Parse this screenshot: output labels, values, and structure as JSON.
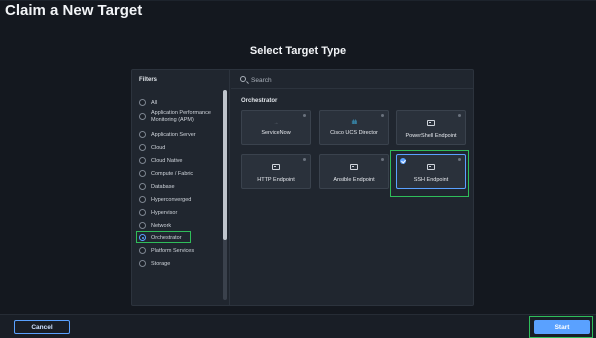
{
  "page": {
    "title": "Claim a New Target"
  },
  "main": {
    "section_title": "Select Target Type"
  },
  "filters": {
    "heading": "Filters",
    "items": [
      {
        "label": "All",
        "selected": false
      },
      {
        "label": "Application Performance Monitoring (APM)",
        "selected": false
      },
      {
        "label": "Application Server",
        "selected": false
      },
      {
        "label": "Cloud",
        "selected": false
      },
      {
        "label": "Cloud Native",
        "selected": false
      },
      {
        "label": "Compute / Fabric",
        "selected": false
      },
      {
        "label": "Database",
        "selected": false
      },
      {
        "label": "Hyperconverged",
        "selected": false
      },
      {
        "label": "Hypervisor",
        "selected": false
      },
      {
        "label": "Network",
        "selected": false
      },
      {
        "label": "Orchestrator",
        "selected": true
      },
      {
        "label": "Platform Services",
        "selected": false
      },
      {
        "label": "Storage",
        "selected": false
      }
    ]
  },
  "search": {
    "placeholder": "Search",
    "value": ""
  },
  "group": {
    "heading": "Orchestrator",
    "cards": [
      {
        "label": "ServiceNow",
        "icon": "servicenow-icon",
        "selected": false
      },
      {
        "label": "Cisco UCS Director",
        "icon": "cisco-icon",
        "selected": false
      },
      {
        "label": "PowerShell Endpoint",
        "icon": "terminal-icon",
        "selected": false
      },
      {
        "label": "HTTP Endpoint",
        "icon": "terminal-icon",
        "selected": false
      },
      {
        "label": "Ansible Endpoint",
        "icon": "terminal-icon",
        "selected": false
      },
      {
        "label": "SSH Endpoint",
        "icon": "terminal-icon",
        "selected": true
      }
    ]
  },
  "footer": {
    "cancel_label": "Cancel",
    "start_label": "Start"
  },
  "colors": {
    "accent": "#5aa1ff",
    "highlight": "#2fbd5a",
    "background": "#14181f",
    "panel": "#20262f"
  }
}
